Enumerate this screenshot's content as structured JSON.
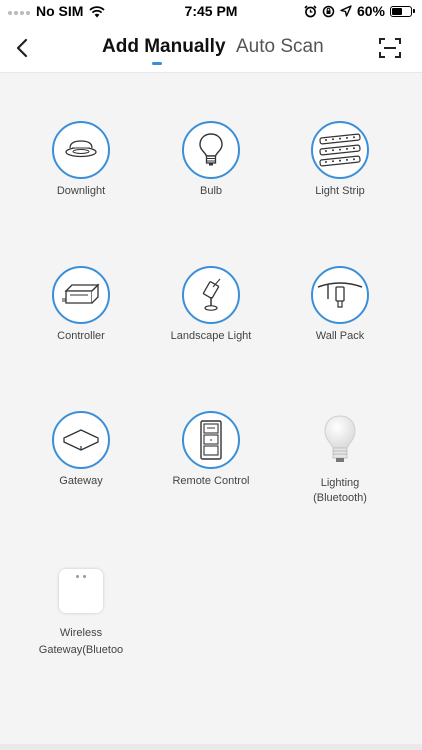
{
  "status_bar": {
    "carrier": "No SIM",
    "time": "7:45 PM",
    "battery": "60%",
    "battery_level": 0.6
  },
  "nav": {
    "back_icon": "chevron-left-icon",
    "tabs": [
      {
        "label": "Add Manually",
        "selected": true
      },
      {
        "label": "Auto Scan",
        "selected": false
      }
    ],
    "scan_icon": "scan-frame-icon",
    "accent_color": "#3a8fd9"
  },
  "devices": [
    {
      "label": "Downlight",
      "icon": "downlight-icon"
    },
    {
      "label": "Bulb",
      "icon": "bulb-icon"
    },
    {
      "label": "Light Strip",
      "icon": "light-strip-icon"
    },
    {
      "label": "Controller",
      "icon": "controller-icon"
    },
    {
      "label": "Landscape Light",
      "icon": "landscape-light-icon"
    },
    {
      "label": "Wall Pack",
      "icon": "wall-pack-icon"
    },
    {
      "label": "Gateway",
      "icon": "gateway-icon"
    },
    {
      "label": "Remote Control",
      "icon": "remote-control-icon"
    },
    {
      "label": "Lighting",
      "sublabel": "(Bluetooth)",
      "icon": "bluetooth-bulb-icon"
    },
    {
      "label": "Wireless Gateway(Bluetoo",
      "icon": "wireless-gateway-icon"
    }
  ]
}
